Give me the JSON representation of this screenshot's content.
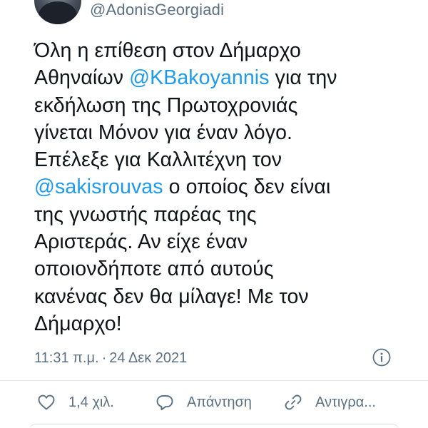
{
  "author": {
    "handle": "@AdonisGeorgiadi"
  },
  "tweet": {
    "lines": [
      [
        {
          "text": "Όλη η επίθεση στον Δήμαρχο"
        }
      ],
      [
        {
          "text": "Αθηναίων "
        },
        {
          "text": "@KBakoyannis",
          "mention": true
        },
        {
          "text": " για την"
        }
      ],
      [
        {
          "text": "εκδήλωση της Πρωτοχρονιάς"
        }
      ],
      [
        {
          "text": "γίνεται Μόνον για έναν λόγο."
        }
      ],
      [
        {
          "text": "Επέλεξε για Καλλιτέχνη τον"
        }
      ],
      [
        {
          "text": "@sakisrouvas",
          "mention": true
        },
        {
          "text": " ο οποίος δεν είναι"
        }
      ],
      [
        {
          "text": "της γνωστής παρέας της"
        }
      ],
      [
        {
          "text": "Αριστεράς. Αν είχε έναν"
        }
      ],
      [
        {
          "text": "οποιονδήποτε από αυτούς"
        }
      ],
      [
        {
          "text": "κανένας δεν θα μίλαγε! Με τον"
        }
      ],
      [
        {
          "text": "Δήμαρχο!"
        }
      ]
    ],
    "time": "11:31 π.μ.",
    "separator": "·",
    "date": "24 Δεκ 2021"
  },
  "actions": {
    "like": {
      "label": "1,4 χιλ.",
      "icon": "heart-outline-icon"
    },
    "reply": {
      "label": "Απάντηση",
      "icon": "speech-bubble-icon"
    },
    "retweet": {
      "label": "Αντιγρα...",
      "icon": "link-icon"
    }
  },
  "colors": {
    "text": "#0f1419",
    "secondary": "#5b7083",
    "mention": "#1d9bf0",
    "divider": "#e3e7ea"
  }
}
